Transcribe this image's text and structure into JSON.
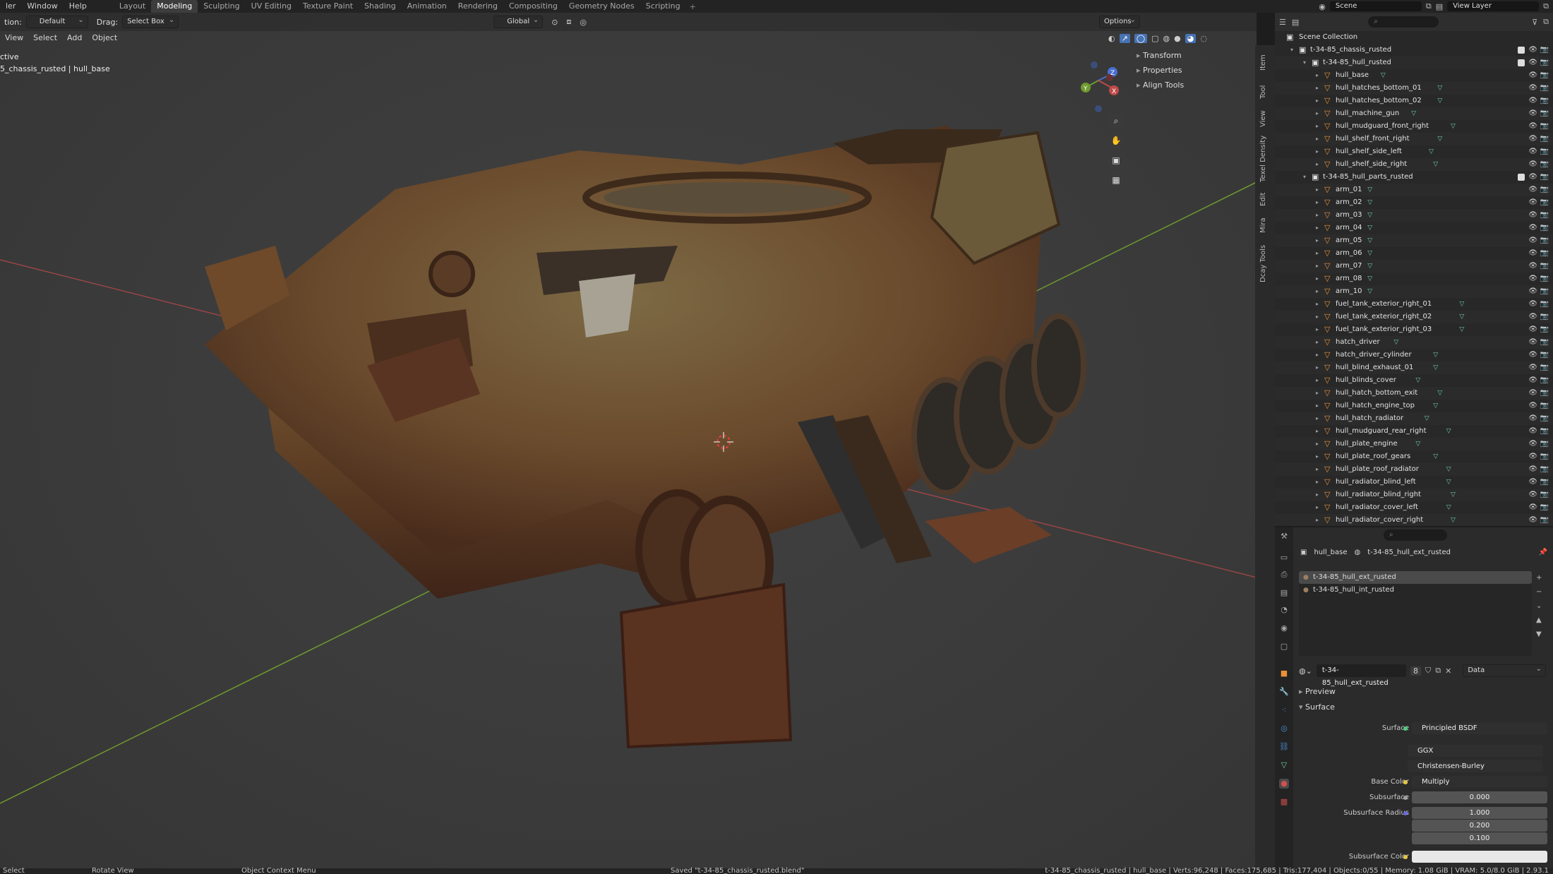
{
  "menubar": {
    "menus": [
      "ler",
      "Window",
      "Help"
    ],
    "workspaces": [
      "Layout",
      "Modeling",
      "Sculpting",
      "UV Editing",
      "Texture Paint",
      "Shading",
      "Animation",
      "Rendering",
      "Compositing",
      "Geometry Nodes",
      "Scripting"
    ],
    "active_workspace": "Modeling",
    "scene": "Scene",
    "view_layer": "View Layer"
  },
  "viewport": {
    "orientation_label": "tion:",
    "orientation_value": "Default",
    "drag_label": "Drag:",
    "drag_value": "Select Box",
    "transform_space": "Global",
    "options_label": "Options",
    "menus": [
      "View",
      "Select",
      "Add",
      "Object"
    ],
    "overlay_line1": "ctive",
    "overlay_line2": "5_chassis_rusted | hull_base",
    "npanel_sections": [
      "Transform",
      "Properties",
      "Align Tools"
    ],
    "side_tabs": [
      "Item",
      "Tool",
      "View",
      "Texel Density",
      "Edit",
      "Mira",
      "Dcay Tools"
    ],
    "gizmo_axes": [
      "X",
      "Y",
      "Z"
    ]
  },
  "outliner": {
    "root": "Scene Collection",
    "rows": [
      {
        "depth": 1,
        "type": "collection",
        "name": "t-34-85_chassis_rusted",
        "checkbox": true
      },
      {
        "depth": 2,
        "type": "collection",
        "name": "t-34-85_hull_rusted",
        "checkbox": true
      },
      {
        "depth": 3,
        "type": "object",
        "name": "hull_base"
      },
      {
        "depth": 3,
        "type": "object",
        "name": "hull_hatches_bottom_01"
      },
      {
        "depth": 3,
        "type": "object",
        "name": "hull_hatches_bottom_02"
      },
      {
        "depth": 3,
        "type": "object",
        "name": "hull_machine_gun"
      },
      {
        "depth": 3,
        "type": "object",
        "name": "hull_mudguard_front_right"
      },
      {
        "depth": 3,
        "type": "object",
        "name": "hull_shelf_front_right"
      },
      {
        "depth": 3,
        "type": "object",
        "name": "hull_shelf_side_left"
      },
      {
        "depth": 3,
        "type": "object",
        "name": "hull_shelf_side_right"
      },
      {
        "depth": 2,
        "type": "collection",
        "name": "t-34-85_hull_parts_rusted",
        "checkbox": true
      },
      {
        "depth": 3,
        "type": "object",
        "name": "arm_01"
      },
      {
        "depth": 3,
        "type": "object",
        "name": "arm_02"
      },
      {
        "depth": 3,
        "type": "object",
        "name": "arm_03"
      },
      {
        "depth": 3,
        "type": "object",
        "name": "arm_04"
      },
      {
        "depth": 3,
        "type": "object",
        "name": "arm_05"
      },
      {
        "depth": 3,
        "type": "object",
        "name": "arm_06"
      },
      {
        "depth": 3,
        "type": "object",
        "name": "arm_07"
      },
      {
        "depth": 3,
        "type": "object",
        "name": "arm_08"
      },
      {
        "depth": 3,
        "type": "object",
        "name": "arm_10"
      },
      {
        "depth": 3,
        "type": "object",
        "name": "fuel_tank_exterior_right_01"
      },
      {
        "depth": 3,
        "type": "object",
        "name": "fuel_tank_exterior_right_02"
      },
      {
        "depth": 3,
        "type": "object",
        "name": "fuel_tank_exterior_right_03"
      },
      {
        "depth": 3,
        "type": "object",
        "name": "hatch_driver"
      },
      {
        "depth": 3,
        "type": "object",
        "name": "hatch_driver_cylinder"
      },
      {
        "depth": 3,
        "type": "object",
        "name": "hull_blind_exhaust_01"
      },
      {
        "depth": 3,
        "type": "object",
        "name": "hull_blinds_cover"
      },
      {
        "depth": 3,
        "type": "object",
        "name": "hull_hatch_bottom_exit"
      },
      {
        "depth": 3,
        "type": "object",
        "name": "hull_hatch_engine_top"
      },
      {
        "depth": 3,
        "type": "object",
        "name": "hull_hatch_radiator"
      },
      {
        "depth": 3,
        "type": "object",
        "name": "hull_mudguard_rear_right"
      },
      {
        "depth": 3,
        "type": "object",
        "name": "hull_plate_engine"
      },
      {
        "depth": 3,
        "type": "object",
        "name": "hull_plate_roof_gears"
      },
      {
        "depth": 3,
        "type": "object",
        "name": "hull_plate_roof_radiator"
      },
      {
        "depth": 3,
        "type": "object",
        "name": "hull_radiator_blind_left"
      },
      {
        "depth": 3,
        "type": "object",
        "name": "hull_radiator_blind_right"
      },
      {
        "depth": 3,
        "type": "object",
        "name": "hull_radiator_cover_left"
      },
      {
        "depth": 3,
        "type": "object",
        "name": "hull_radiator_cover_right"
      }
    ]
  },
  "properties": {
    "object_name": "hull_base",
    "material_crumb": "t-34-85_hull_ext_rusted",
    "slots": [
      "t-34-85_hull_ext_rusted",
      "t-34-85_hull_int_rusted"
    ],
    "active_slot": 0,
    "material_name": "t-34-85_hull_ext_rusted",
    "user_count": "8",
    "link_mode": "Data",
    "preview_label": "Preview",
    "surface_header": "Surface",
    "surface_label": "Surface",
    "surface_value": "Principled BSDF",
    "distribution": "GGX",
    "subsurface_method": "Christensen-Burley",
    "base_color_label": "Base Color",
    "base_color_value": "Multiply",
    "subsurface_label": "Subsurface",
    "subsurface_value": "0.000",
    "subsurface_radius_label": "Subsurface Radius",
    "subsurface_radius": [
      "1.000",
      "0.200",
      "0.100"
    ],
    "subsurface_color_label": "Subsurface Color"
  },
  "statusbar": {
    "select": "Select",
    "rotate": "Rotate View",
    "context_menu": "Object Context Menu",
    "saved": "Saved \"t-34-85_chassis_rusted.blend\"",
    "stats": "t-34-85_chassis_rusted | hull_base | Verts:96,248 | Faces:175,685 | Tris:177,404 | Objects:0/55 | Memory: 1.08 GiB | VRAM: 5.0/8.0 GiB | 2.93.1"
  },
  "colors": {
    "x_axis": "#a04444",
    "y_axis": "#6f9a2f",
    "rust": "#6b3a22",
    "accent": "#4772b3",
    "mesh_icon": "#6fcfa0",
    "object_icon": "#e8913a"
  }
}
